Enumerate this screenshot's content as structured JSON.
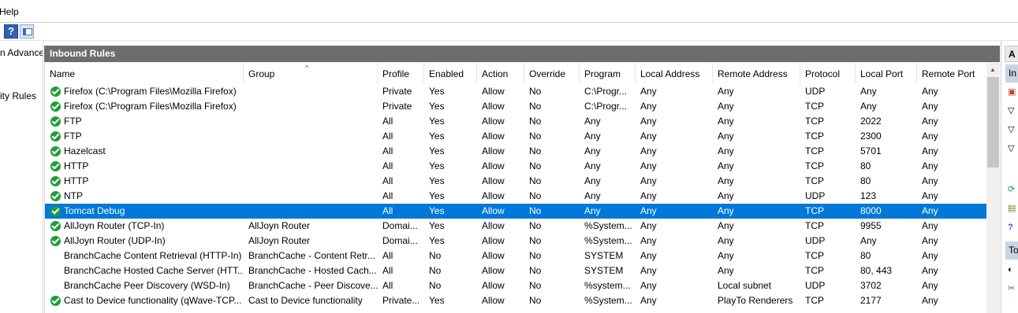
{
  "menu": {
    "help_label": "Help"
  },
  "toolbar": {
    "help_icon_glyph": "?"
  },
  "left_tree": {
    "items": [
      "n Advance",
      "ity Rules"
    ]
  },
  "panel": {
    "title": "Inbound Rules"
  },
  "columns": [
    "Name",
    "Group",
    "Profile",
    "Enabled",
    "Action",
    "Override",
    "Program",
    "Local Address",
    "Remote Address",
    "Protocol",
    "Local Port",
    "Remote Port"
  ],
  "rows": [
    {
      "icon": true,
      "selected": false,
      "cells": [
        "Firefox (C:\\Program Files\\Mozilla Firefox)",
        "",
        "Private",
        "Yes",
        "Allow",
        "No",
        "C:\\Progr...",
        "Any",
        "Any",
        "UDP",
        "Any",
        "Any"
      ]
    },
    {
      "icon": true,
      "selected": false,
      "cells": [
        "Firefox (C:\\Program Files\\Mozilla Firefox)",
        "",
        "Private",
        "Yes",
        "Allow",
        "No",
        "C:\\Progr...",
        "Any",
        "Any",
        "TCP",
        "Any",
        "Any"
      ]
    },
    {
      "icon": true,
      "selected": false,
      "cells": [
        "FTP",
        "",
        "All",
        "Yes",
        "Allow",
        "No",
        "Any",
        "Any",
        "Any",
        "TCP",
        "2022",
        "Any"
      ]
    },
    {
      "icon": true,
      "selected": false,
      "cells": [
        "FTP",
        "",
        "All",
        "Yes",
        "Allow",
        "No",
        "Any",
        "Any",
        "Any",
        "TCP",
        "2300",
        "Any"
      ]
    },
    {
      "icon": true,
      "selected": false,
      "cells": [
        "Hazelcast",
        "",
        "All",
        "Yes",
        "Allow",
        "No",
        "Any",
        "Any",
        "Any",
        "TCP",
        "5701",
        "Any"
      ]
    },
    {
      "icon": true,
      "selected": false,
      "cells": [
        "HTTP",
        "",
        "All",
        "Yes",
        "Allow",
        "No",
        "Any",
        "Any",
        "Any",
        "TCP",
        "80",
        "Any"
      ]
    },
    {
      "icon": true,
      "selected": false,
      "cells": [
        "HTTP",
        "",
        "All",
        "Yes",
        "Allow",
        "No",
        "Any",
        "Any",
        "Any",
        "TCP",
        "80",
        "Any"
      ]
    },
    {
      "icon": true,
      "selected": false,
      "cells": [
        "NTP",
        "",
        "All",
        "Yes",
        "Allow",
        "No",
        "Any",
        "Any",
        "Any",
        "UDP",
        "123",
        "Any"
      ]
    },
    {
      "icon": true,
      "selected": true,
      "cells": [
        "Tomcat Debug",
        "",
        "All",
        "Yes",
        "Allow",
        "No",
        "Any",
        "Any",
        "Any",
        "TCP",
        "8000",
        "Any"
      ]
    },
    {
      "icon": true,
      "selected": false,
      "cells": [
        "AllJoyn Router (TCP-In)",
        "AllJoyn Router",
        "Domai...",
        "Yes",
        "Allow",
        "No",
        "%System...",
        "Any",
        "Any",
        "TCP",
        "9955",
        "Any"
      ]
    },
    {
      "icon": true,
      "selected": false,
      "cells": [
        "AllJoyn Router (UDP-In)",
        "AllJoyn Router",
        "Domai...",
        "Yes",
        "Allow",
        "No",
        "%System...",
        "Any",
        "Any",
        "UDP",
        "Any",
        "Any"
      ]
    },
    {
      "icon": false,
      "selected": false,
      "cells": [
        "BranchCache Content Retrieval (HTTP-In)",
        "BranchCache - Content Retr...",
        "All",
        "No",
        "Allow",
        "No",
        "SYSTEM",
        "Any",
        "Any",
        "TCP",
        "80",
        "Any"
      ]
    },
    {
      "icon": false,
      "selected": false,
      "cells": [
        "BranchCache Hosted Cache Server (HTT...",
        "BranchCache - Hosted Cach...",
        "All",
        "No",
        "Allow",
        "No",
        "SYSTEM",
        "Any",
        "Any",
        "TCP",
        "80, 443",
        "Any"
      ]
    },
    {
      "icon": false,
      "selected": false,
      "cells": [
        "BranchCache Peer Discovery (WSD-In)",
        "BranchCache - Peer Discove...",
        "All",
        "No",
        "Allow",
        "No",
        "%system...",
        "Any",
        "Local subnet",
        "UDP",
        "3702",
        "Any"
      ]
    },
    {
      "icon": true,
      "selected": false,
      "cells": [
        "Cast to Device functionality (qWave-TCP...",
        "Cast to Device functionality",
        "Private...",
        "Yes",
        "Allow",
        "No",
        "%System...",
        "Any",
        "PlayTo Renderers",
        "TCP",
        "2177",
        "Any"
      ]
    }
  ],
  "actions": {
    "title": "A",
    "sub1": "In",
    "sub2": "To"
  },
  "colors": {
    "selection": "#0078d7",
    "title_bar": "#6d6d6d",
    "enabled_icon": "#1f9d3a"
  }
}
